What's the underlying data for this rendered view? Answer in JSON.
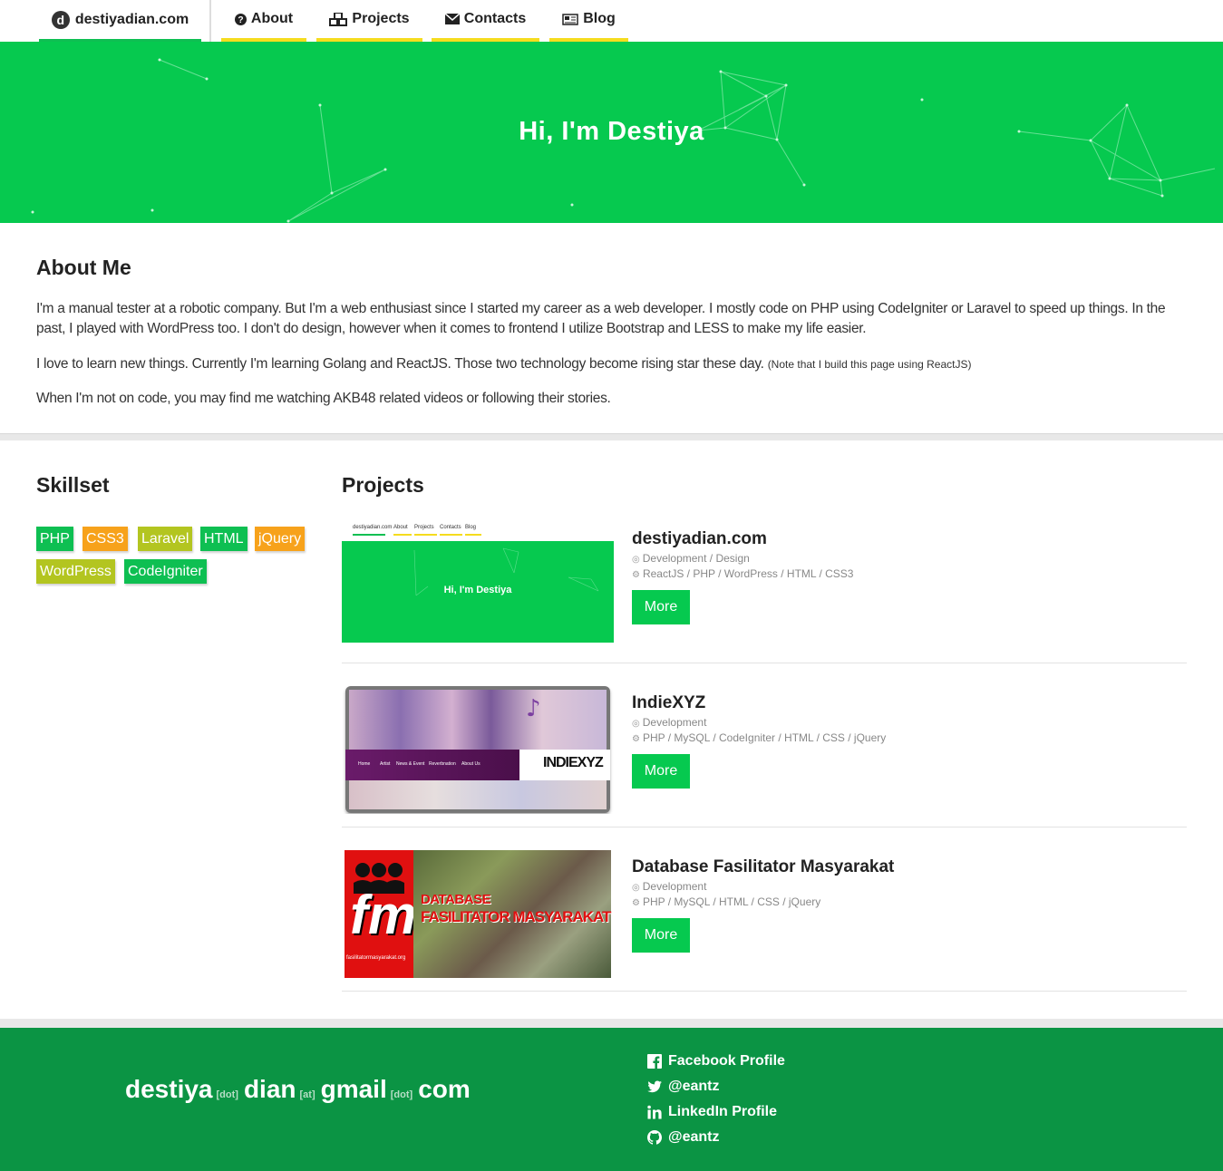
{
  "nav": {
    "brand": "destiyadian.com",
    "brand_logo_letter": "d",
    "items": [
      {
        "label": "About",
        "icon": "question-circle-icon"
      },
      {
        "label": "Projects",
        "icon": "cubes-icon"
      },
      {
        "label": "Contacts",
        "icon": "envelope-icon"
      },
      {
        "label": "Blog",
        "icon": "newspaper-icon"
      }
    ]
  },
  "hero": {
    "title": "Hi, I'm Destiya"
  },
  "about": {
    "heading": "About Me",
    "p1": "I'm a manual tester at a robotic company. But I'm a web enthusiast since I started my career as a web developer. I mostly code on PHP using CodeIgniter or Laravel to speed up things. In the past, I played with WordPress too. I don't do design, however when it comes to frontend I utilize Bootstrap and LESS to make my life easier.",
    "p2": "I love to learn new things. Currently I'm learning Golang and ReactJS. Those two technology become rising star these day.",
    "p2_note": "(Note that I build this page using ReactJS)",
    "p3": "When I'm not on code, you may find me watching AKB48 related videos or following their stories."
  },
  "skills": {
    "heading": "Skillset",
    "tags": [
      {
        "label": "PHP",
        "color": "#0ebf52"
      },
      {
        "label": "CSS3",
        "color": "#f7a21b"
      },
      {
        "label": "Laravel",
        "color": "#b3c520"
      },
      {
        "label": "HTML",
        "color": "#0ebf52"
      },
      {
        "label": "jQuery",
        "color": "#f7a21b"
      },
      {
        "label": "WordPress",
        "color": "#b3c520"
      },
      {
        "label": "CodeIgniter",
        "color": "#0ebf52"
      }
    ]
  },
  "projects": {
    "heading": "Projects",
    "items": [
      {
        "title": "destiyadian.com",
        "role": "Development / Design",
        "stack": "ReactJS / PHP / WordPress / HTML / CSS3",
        "more": "More",
        "thumb_text": "Hi, I'm Destiya",
        "thumb_nav": [
          "destiyadian.com",
          "About",
          "Projects",
          "Contacts",
          "Blog"
        ]
      },
      {
        "title": "IndieXYZ",
        "role": "Development",
        "stack": "PHP / MySQL / CodeIgniter / HTML / CSS / jQuery",
        "more": "More",
        "thumb_logo": "INDIEXYZ",
        "thumb_nav": [
          "Home",
          "Artist",
          "News & Event",
          "Reverbnation",
          "About Us"
        ]
      },
      {
        "title": "Database Fasilitator Masyarakat",
        "role": "Development",
        "stack": "PHP / MySQL / HTML / CSS / jQuery",
        "more": "More",
        "thumb_line1": "DATABASE",
        "thumb_line2": "FASILITATOR MASYARAKAT",
        "thumb_logo": "fm",
        "thumb_url": "fasilitatormasyarakat.org"
      }
    ]
  },
  "footer": {
    "email_parts": [
      "destiya",
      "[dot]",
      "dian",
      "[at]",
      "gmail",
      "[dot]",
      "com"
    ],
    "social": [
      {
        "label": "Facebook Profile",
        "icon": "facebook-icon"
      },
      {
        "label": "@eantz",
        "icon": "twitter-icon"
      },
      {
        "label": "LinkedIn Profile",
        "icon": "linkedin-icon"
      },
      {
        "label": "@eantz",
        "icon": "github-icon"
      }
    ]
  },
  "colors": {
    "accent_green": "#06c94f",
    "footer_green": "#0b9444",
    "nav_underline": "#f5dc1e"
  }
}
